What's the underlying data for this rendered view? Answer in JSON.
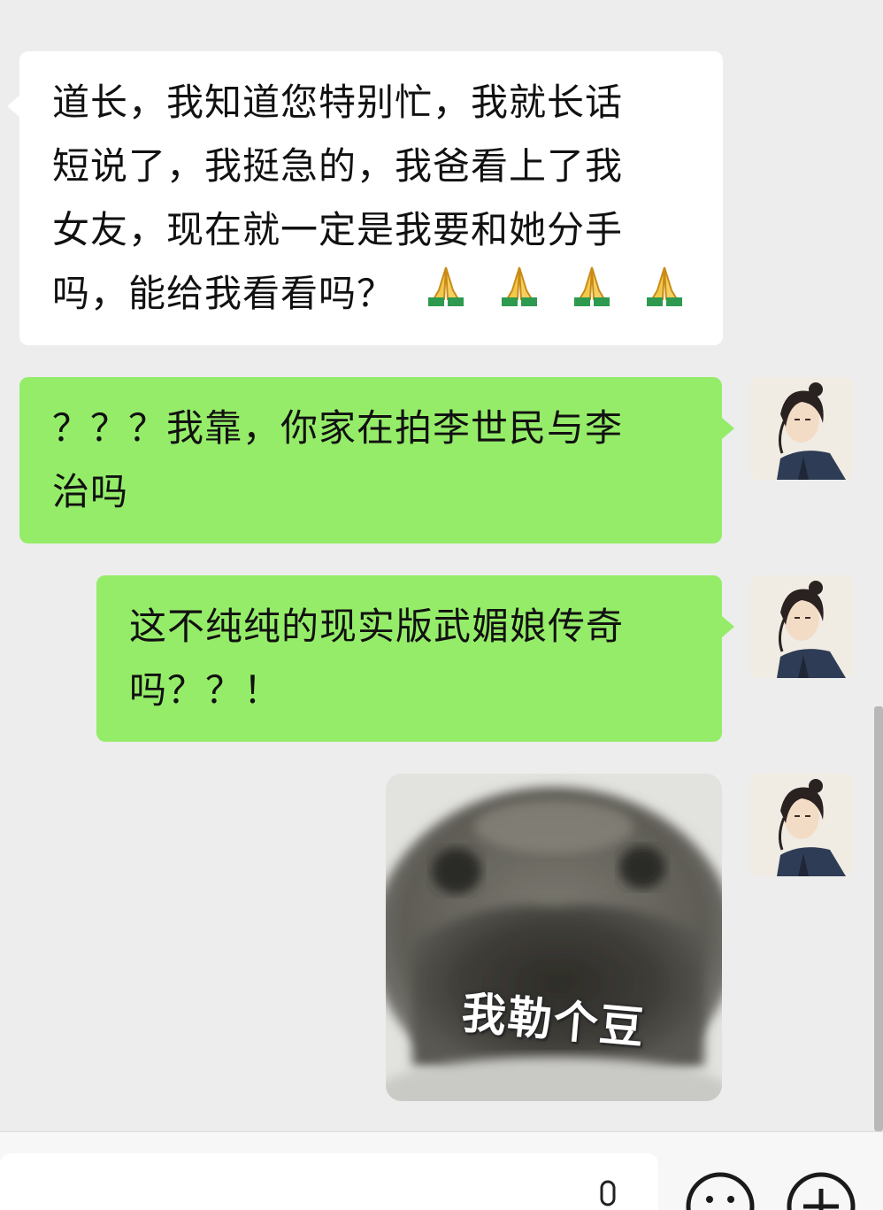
{
  "messages": [
    {
      "side": "left",
      "lines": [
        "道长，我知道您特别忙，我就长话",
        "短说了，我挺急的，我爸看上了我",
        "女友，现在就一定是我要和她分手",
        "吗，能给我看看吗？"
      ],
      "emoji_count": 4,
      "emoji_icon": "folded-hands-icon"
    },
    {
      "side": "right",
      "lines": [
        "？？？我靠，你家在拍李世民与李",
        "治吗"
      ]
    },
    {
      "side": "right",
      "lines": [
        "这不纯纯的现实版武媚娘传奇",
        "吗？？！"
      ]
    },
    {
      "side": "right",
      "type": "sticker",
      "caption": "我勒个豆"
    }
  ],
  "input": {
    "value": "",
    "placeholder": ""
  },
  "icons": {
    "voice": "microphone-icon",
    "emoji": "smiley-icon",
    "more": "plus-icon"
  },
  "colors": {
    "background": "#ededed",
    "sent_bubble": "#95ec69",
    "received_bubble": "#ffffff"
  }
}
